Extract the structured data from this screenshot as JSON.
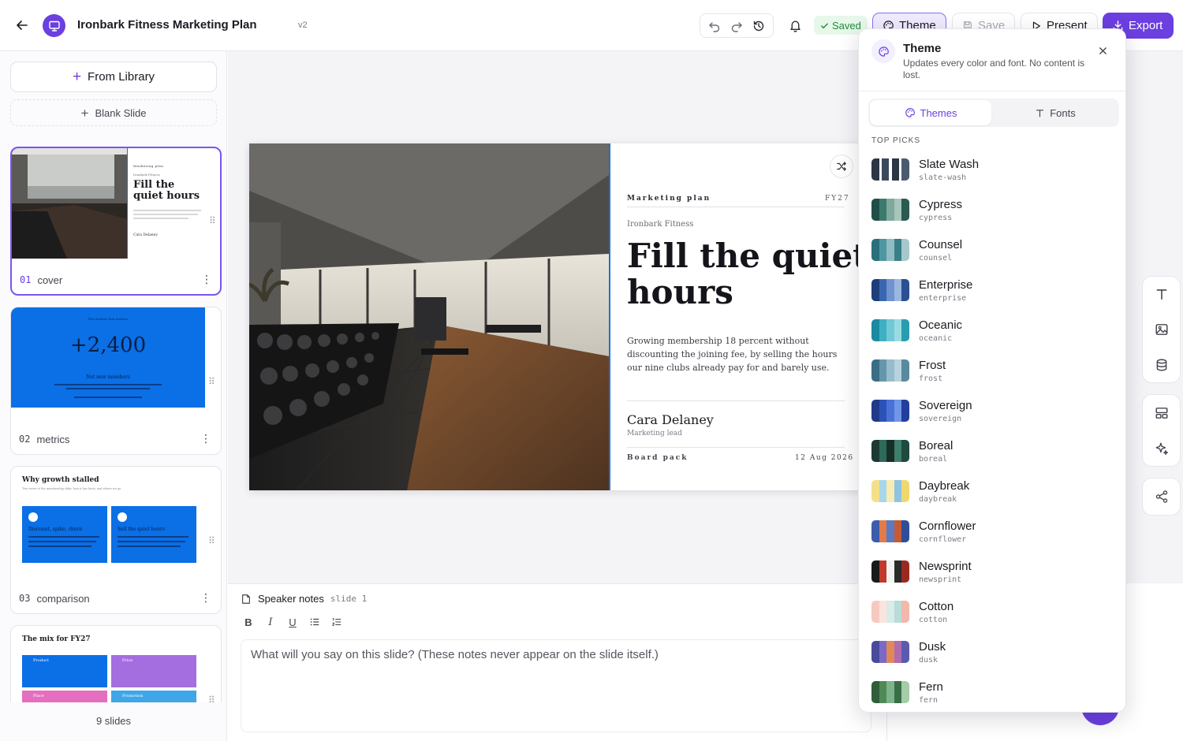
{
  "header": {
    "title": "Ironbark Fitness Marketing Plan",
    "version": "v2",
    "saved_label": "Saved",
    "theme_label": "Theme",
    "save_label": "Save",
    "present_label": "Present",
    "export_label": "Export"
  },
  "sidebar": {
    "from_library": "From Library",
    "blank_slide": "Blank Slide",
    "slides": [
      {
        "num": "01",
        "name": "cover"
      },
      {
        "num": "02",
        "name": "metrics"
      },
      {
        "num": "03",
        "name": "comparison"
      }
    ],
    "count": "9 slides",
    "thumbs": {
      "cover": {
        "kicker": "Marketing plan",
        "brand": "Ironbark Fitness",
        "title": "Fill the quiet hours",
        "author": "Cara Delaney"
      },
      "metrics": {
        "kicker": "The number that matters",
        "value": "+2,400",
        "label": "Net new members"
      },
      "comparison": {
        "title": "Why growth stalled",
        "subtitle": "Two views of the membership slide: how it has been, and where we go",
        "left": "Discount, spike, churn",
        "right": "Sell the quiet hours"
      },
      "mix": {
        "title": "The mix for FY27",
        "items": [
          "Product",
          "Price",
          "Place",
          "Promotion"
        ]
      }
    }
  },
  "slide": {
    "kicker": "Marketing plan",
    "fy": "FY27",
    "brand": "Ironbark Fitness",
    "title_line1": "Fill the quiet",
    "title_line2": "hours",
    "body": "Growing membership 18 percent without discounting the joining fee, by selling the hours our nine clubs already pay for and barely use.",
    "author": "Cara Delaney",
    "role": "Marketing lead",
    "footer_left": "Board pack",
    "footer_right": "12 Aug 2026"
  },
  "notes": {
    "title": "Speaker notes",
    "slide_ref": "slide 1",
    "placeholder": "What will you say on this slide? (These notes never appear on the slide itself.)"
  },
  "theme_panel": {
    "title": "Theme",
    "description": "Updates every color and font. No content is lost.",
    "tab_themes": "Themes",
    "tab_fonts": "Fonts",
    "section": "TOP PICKS",
    "themes": [
      {
        "name": "Slate Wash",
        "id": "slate-wash",
        "colors": [
          "#2b3644",
          "#ffffff",
          "#3a4a5e",
          "#ffffff",
          "#2b3644",
          "#ffffff",
          "#4a5a70"
        ]
      },
      {
        "name": "Cypress",
        "id": "cypress",
        "colors": [
          "#1f4e46",
          "#3d7a6e",
          "#7fa99c",
          "#a7c5bb",
          "#2a5a50"
        ]
      },
      {
        "name": "Counsel",
        "id": "counsel",
        "colors": [
          "#2a6f7a",
          "#4e97a0",
          "#8fbcc2",
          "#3a7e88",
          "#a6c8cc"
        ]
      },
      {
        "name": "Enterprise",
        "id": "enterprise",
        "colors": [
          "#1c3f7a",
          "#3a66b0",
          "#6f93cf",
          "#9bb7e0",
          "#2a4f92"
        ]
      },
      {
        "name": "Oceanic",
        "id": "oceanic",
        "colors": [
          "#1a8aa0",
          "#3fb0c2",
          "#6fcad6",
          "#9adbe3",
          "#2a9cb0"
        ]
      },
      {
        "name": "Frost",
        "id": "frost",
        "colors": [
          "#3a6e84",
          "#6596ab",
          "#95bccb",
          "#b8d3dd",
          "#4e82984"
        ]
      },
      {
        "name": "Sovereign",
        "id": "sovereign",
        "colors": [
          "#1e3a8a",
          "#2c52b8",
          "#4a72d6",
          "#7096e6",
          "#233f9c"
        ]
      },
      {
        "name": "Boreal",
        "id": "boreal",
        "colors": [
          "#1b3a34",
          "#2e6a5a",
          "#163028",
          "#3e7e6a",
          "#1f4a40"
        ]
      },
      {
        "name": "Daybreak",
        "id": "daybreak",
        "colors": [
          "#f4e08a",
          "#a8d6ea",
          "#f7ecb2",
          "#8ec4e0",
          "#f0d870"
        ]
      },
      {
        "name": "Cornflower",
        "id": "cornflower",
        "colors": [
          "#3b5dab",
          "#e27a4a",
          "#5a7ac4",
          "#c65a34",
          "#2e4e98"
        ]
      },
      {
        "name": "Newsprint",
        "id": "newsprint",
        "colors": [
          "#1a1a1a",
          "#c0392b",
          "#f2f2f2",
          "#2a2a2a",
          "#9a2a20"
        ]
      },
      {
        "name": "Cotton",
        "id": "cotton",
        "colors": [
          "#f6c9c0",
          "#fbe3de",
          "#d8ece8",
          "#b9dcd6",
          "#f2b8ac"
        ]
      },
      {
        "name": "Dusk",
        "id": "dusk",
        "colors": [
          "#4a4a9a",
          "#7a6ac8",
          "#e0885a",
          "#b06ab0",
          "#5a5ab0"
        ]
      },
      {
        "name": "Fern",
        "id": "fern",
        "colors": [
          "#2e5e3a",
          "#4e8a58",
          "#7fb38a",
          "#3a6e46",
          "#a4cca8"
        ]
      }
    ]
  },
  "colors": {
    "accent": "#6b3fe0",
    "slide_blue": "#1e6fdc"
  }
}
